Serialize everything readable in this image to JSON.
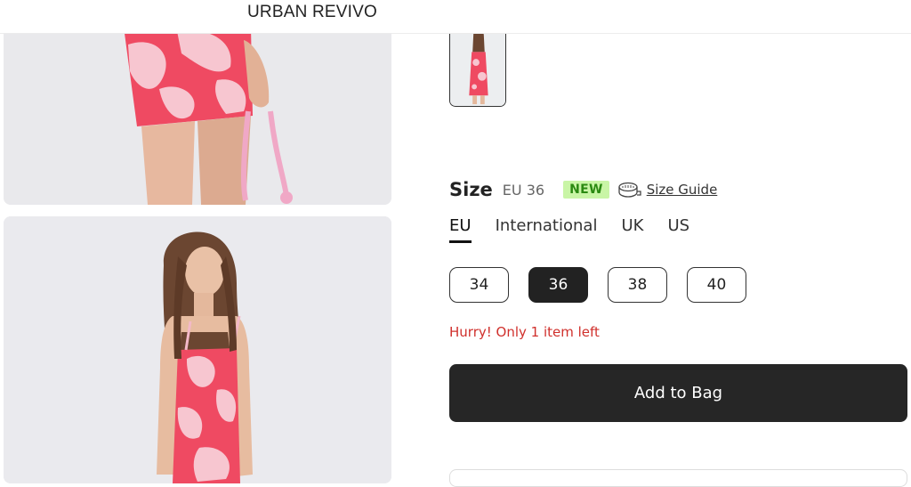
{
  "header": {
    "brand": "URBAN REVIVO"
  },
  "gallery": {
    "image1": "dress-detail-photo",
    "image2": "model-dress-photo",
    "thumbnail": "dress-thumbnail"
  },
  "size": {
    "title": "Size",
    "current": "EU 36",
    "badge": "NEW",
    "guide_icon": "tape-measure-icon",
    "guide_label": "Size Guide"
  },
  "size_systems": [
    {
      "label": "EU",
      "active": true
    },
    {
      "label": "International",
      "active": false
    },
    {
      "label": "UK",
      "active": false
    },
    {
      "label": "US",
      "active": false
    }
  ],
  "size_options": [
    {
      "label": "34",
      "selected": false
    },
    {
      "label": "36",
      "selected": true
    },
    {
      "label": "38",
      "selected": false
    },
    {
      "label": "40",
      "selected": false
    }
  ],
  "stock_message": "Hurry! Only 1 item left",
  "cart": {
    "add_label": "Add to Bag"
  },
  "colors": {
    "accent": "#262626",
    "alert": "#d0302c",
    "badge_bg": "#c9f5a6",
    "badge_text": "#2b8a12"
  }
}
